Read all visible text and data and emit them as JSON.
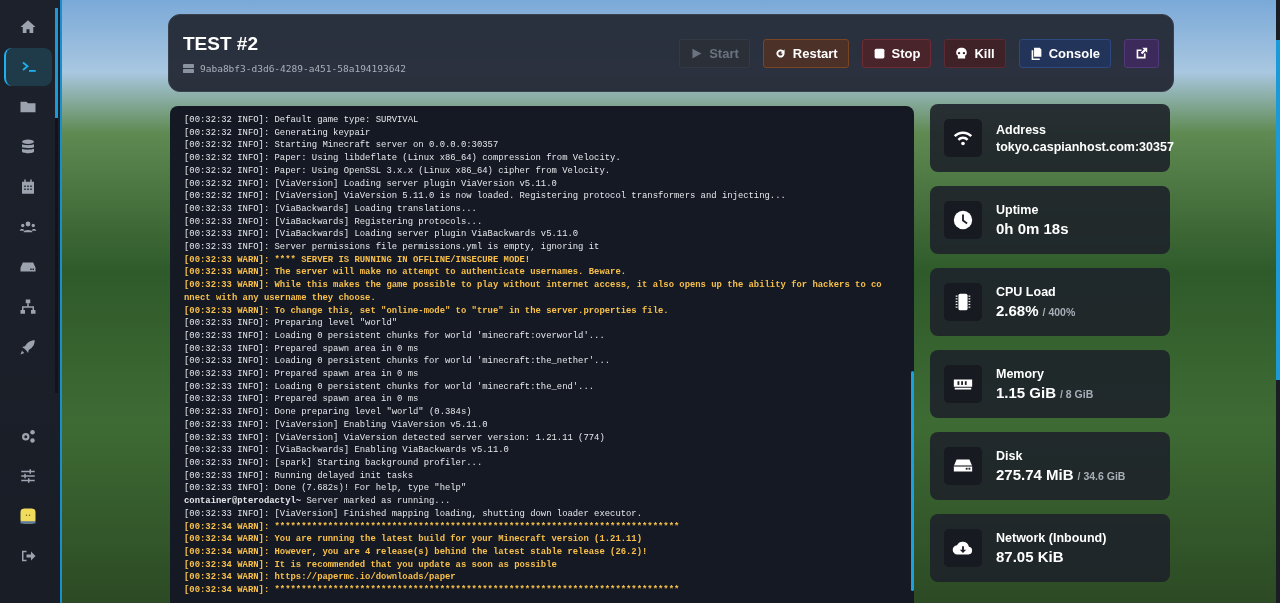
{
  "sidebar": {
    "items": [
      {
        "selected": false
      },
      {
        "selected": true
      },
      {
        "selected": false
      },
      {
        "selected": false
      },
      {
        "selected": false
      },
      {
        "selected": false
      },
      {
        "selected": false
      },
      {
        "selected": false
      },
      {
        "selected": false
      }
    ],
    "bottom_items": [
      {
        "selected": false
      },
      {
        "selected": false
      },
      {
        "selected": false
      },
      {
        "selected": false
      }
    ]
  },
  "server": {
    "name": "TEST #2",
    "uuid": "9aba8bf3-d3d6-4289-a451-58a194193642"
  },
  "buttons": [
    {
      "kind": "start",
      "label": "Start",
      "disabled": true
    },
    {
      "kind": "restart",
      "label": "Restart",
      "disabled": false
    },
    {
      "kind": "stop",
      "label": "Stop",
      "disabled": false
    },
    {
      "kind": "kill",
      "label": "Kill",
      "disabled": false
    },
    {
      "kind": "console",
      "label": "Console",
      "disabled": false
    },
    {
      "kind": "external",
      "disabled": false
    }
  ],
  "console": {
    "lines": [
      {
        "kind": "info",
        "text": "[00:32:32 INFO]: Default game type: SURVIVAL"
      },
      {
        "kind": "info",
        "text": "[00:32:32 INFO]: Generating keypair"
      },
      {
        "kind": "info",
        "text": "[00:32:32 INFO]: Starting Minecraft server on 0.0.0.0:30357"
      },
      {
        "kind": "info",
        "text": "[00:32:32 INFO]: Paper: Using libdeflate (Linux x86_64) compression from Velocity."
      },
      {
        "kind": "info",
        "text": "[00:32:32 INFO]: Paper: Using OpenSSL 3.x.x (Linux x86_64) cipher from Velocity."
      },
      {
        "kind": "info",
        "text": "[00:32:32 INFO]: [ViaVersion] Loading server plugin ViaVersion v5.11.0"
      },
      {
        "kind": "info",
        "text": "[00:32:32 INFO]: [ViaVersion] ViaVersion 5.11.0 is now loaded. Registering protocol transformers and injecting..."
      },
      {
        "kind": "info",
        "text": "[00:32:33 INFO]: [ViaBackwards] Loading translations..."
      },
      {
        "kind": "info",
        "text": "[00:32:33 INFO]: [ViaBackwards] Registering protocols..."
      },
      {
        "kind": "info",
        "text": "[00:32:33 INFO]: [ViaBackwards] Loading server plugin ViaBackwards v5.11.0"
      },
      {
        "kind": "info",
        "text": "[00:32:33 INFO]: Server permissions file permissions.yml is empty, ignoring it"
      },
      {
        "kind": "warn",
        "text": "[00:32:33 WARN]: **** SERVER IS RUNNING IN OFFLINE/INSECURE MODE!"
      },
      {
        "kind": "warn",
        "text": "[00:32:33 WARN]: The server will make no attempt to authenticate usernames. Beware."
      },
      {
        "kind": "warn",
        "text": "[00:32:33 WARN]: While this makes the game possible to play without internet access, it also opens up the ability for hackers to connect with any username they choose."
      },
      {
        "kind": "warn",
        "text": "[00:32:33 WARN]: To change this, set \"online-mode\" to \"true\" in the server.properties file."
      },
      {
        "kind": "info",
        "text": "[00:32:33 INFO]: Preparing level \"world\""
      },
      {
        "kind": "info",
        "text": "[00:32:33 INFO]: Loading 0 persistent chunks for world 'minecraft:overworld'..."
      },
      {
        "kind": "info",
        "text": "[00:32:33 INFO]: Prepared spawn area in 0 ms"
      },
      {
        "kind": "info",
        "text": "[00:32:33 INFO]: Loading 0 persistent chunks for world 'minecraft:the_nether'..."
      },
      {
        "kind": "info",
        "text": "[00:32:33 INFO]: Prepared spawn area in 0 ms"
      },
      {
        "kind": "info",
        "text": "[00:32:33 INFO]: Loading 0 persistent chunks for world 'minecraft:the_end'..."
      },
      {
        "kind": "info",
        "text": "[00:32:33 INFO]: Prepared spawn area in 0 ms"
      },
      {
        "kind": "info",
        "text": "[00:32:33 INFO]: Done preparing level \"world\" (0.384s)"
      },
      {
        "kind": "info",
        "text": "[00:32:33 INFO]: [ViaVersion] Enabling ViaVersion v5.11.0"
      },
      {
        "kind": "info",
        "text": "[00:32:33 INFO]: [ViaVersion] ViaVersion detected server version: 1.21.11 (774)"
      },
      {
        "kind": "info",
        "text": "[00:32:33 INFO]: [ViaBackwards] Enabling ViaBackwards v5.11.0"
      },
      {
        "kind": "info",
        "text": "[00:32:33 INFO]: [spark] Starting background profiler..."
      },
      {
        "kind": "info",
        "text": "[00:32:33 INFO]: Running delayed init tasks"
      },
      {
        "kind": "info",
        "text": "[00:32:33 INFO]: Done (7.682s)! For help, type \"help\""
      },
      {
        "kind": "prompt",
        "text": "**container@pterodactyl~** Server marked as running..."
      },
      {
        "kind": "info",
        "text": "[00:32:33 INFO]: [ViaVersion] Finished mapping loading, shutting down loader executor."
      },
      {
        "kind": "warn",
        "text": "[00:32:34 WARN]: ****************************************************************************"
      },
      {
        "kind": "warn",
        "text": "[00:32:34 WARN]: You are running the latest build for your Minecraft version (1.21.11)"
      },
      {
        "kind": "warn",
        "text": "[00:32:34 WARN]: However, you are 4 release(s) behind the latest stable release (26.2)!"
      },
      {
        "kind": "warn",
        "text": "[00:32:34 WARN]: It is recommended that you update as soon as possible"
      },
      {
        "kind": "warn",
        "text": "[00:32:34 WARN]: https://papermc.io/downloads/paper"
      },
      {
        "kind": "warn",
        "text": "[00:32:34 WARN]: ****************************************************************************"
      }
    ]
  },
  "stats": [
    {
      "kind": "address",
      "label": "Address",
      "value": "tokyo.caspianhost.com:30357"
    },
    {
      "kind": "uptime",
      "label": "Uptime",
      "value": "0h 0m 18s"
    },
    {
      "kind": "cpu",
      "label": "CPU Load",
      "value": "2.68%",
      "limit": "/ 400%"
    },
    {
      "kind": "memory",
      "label": "Memory",
      "value": "1.15 GiB",
      "limit": "/ 8 GiB"
    },
    {
      "kind": "disk",
      "label": "Disk",
      "value": "275.74 MiB",
      "limit": "/ 34.6 GiB"
    },
    {
      "kind": "network",
      "label": "Network (Inbound)",
      "value": "87.05 KiB"
    }
  ]
}
